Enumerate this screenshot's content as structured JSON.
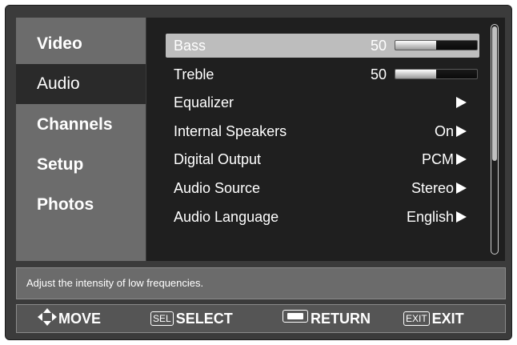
{
  "sidebar": {
    "items": [
      {
        "label": "Video"
      },
      {
        "label": "Audio"
      },
      {
        "label": "Channels"
      },
      {
        "label": "Setup"
      },
      {
        "label": "Photos"
      }
    ],
    "selected": "Audio"
  },
  "settings": {
    "bass": {
      "label": "Bass",
      "value": "50",
      "level": 0.5
    },
    "treble": {
      "label": "Treble",
      "value": "50",
      "level": 0.5
    },
    "equalizer": {
      "label": "Equalizer"
    },
    "internal_speakers": {
      "label": "Internal Speakers",
      "value": "On"
    },
    "digital_output": {
      "label": "Digital Output",
      "value": "PCM"
    },
    "audio_source": {
      "label": "Audio Source",
      "value": "Stereo"
    },
    "audio_language": {
      "label": "Audio Language",
      "value": "English"
    }
  },
  "description": "Adjust the intensity of low frequencies.",
  "hints": {
    "move": {
      "label": "MOVE",
      "icon": "four-way-arrow-icon"
    },
    "select": {
      "key": "SEL",
      "label": "SELECT"
    },
    "return": {
      "key_icon": "return-key-icon",
      "label": "RETURN"
    },
    "exit": {
      "key": "EXIT",
      "label": "EXIT"
    }
  },
  "colors": {
    "highlight": "#bdbdbd",
    "panel": "#1f1f1f",
    "sidebar": "#6c6c6c"
  }
}
